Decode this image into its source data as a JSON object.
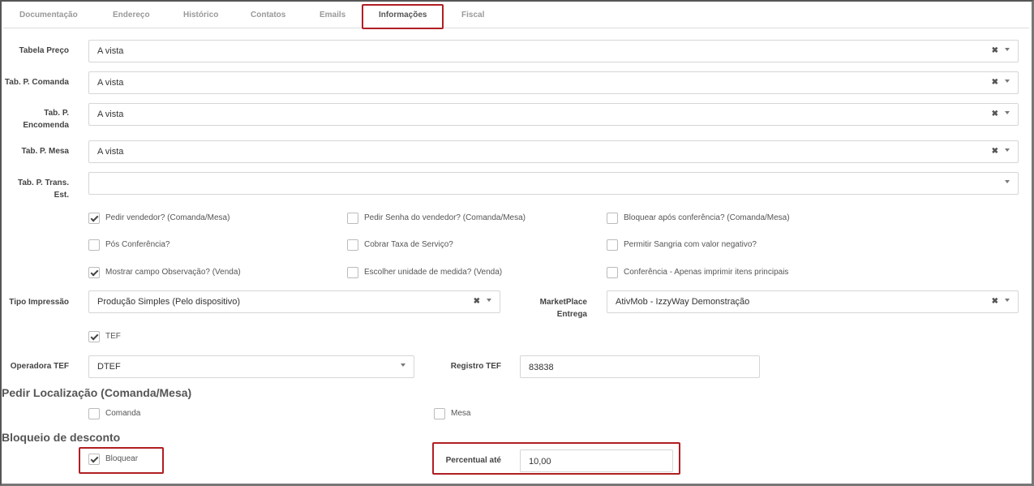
{
  "tabs": [
    {
      "label": "Documentação"
    },
    {
      "label": "Endereço"
    },
    {
      "label": "Histórico"
    },
    {
      "label": "Contatos"
    },
    {
      "label": "Emails"
    },
    {
      "label": "Informações"
    },
    {
      "label": "Fiscal"
    }
  ],
  "price_tables": [
    {
      "label": "Tabela Preço",
      "value": "A vista"
    },
    {
      "label": "Tab. P. Comanda",
      "value": "A vista"
    },
    {
      "label_line1": "Tab. P.",
      "label_line2": "Encomenda",
      "value": "A vista"
    },
    {
      "label": "Tab. P. Mesa",
      "value": "A vista"
    },
    {
      "label_line1": "Tab. P. Trans.",
      "label_line2": "Est.",
      "value": ""
    }
  ],
  "options": [
    {
      "label": "Pedir vendedor? (Comanda/Mesa)",
      "checked": true
    },
    {
      "label": "Pedir Senha do vendedor? (Comanda/Mesa)",
      "checked": false
    },
    {
      "label": "Bloquear após conferência? (Comanda/Mesa)",
      "checked": false
    },
    {
      "label": "Pós Conferência?",
      "checked": false
    },
    {
      "label": "Cobrar Taxa de Serviço?",
      "checked": false
    },
    {
      "label": "Permitir Sangria com valor negativo?",
      "checked": false
    },
    {
      "label": "Mostrar campo Observação? (Venda)",
      "checked": true
    },
    {
      "label": "Escolher unidade de medida? (Venda)",
      "checked": false
    },
    {
      "label": "Conferência - Apenas imprimir itens principais",
      "checked": false
    }
  ],
  "print_type": {
    "label": "Tipo Impressão",
    "value": "Produção Simples (Pelo dispositivo)"
  },
  "marketplace": {
    "label_line1": "MarketPlace",
    "label_line2": "Entrega",
    "value": "AtivMob - IzzyWay Demonstração"
  },
  "tef": {
    "label": "TEF",
    "checked": true
  },
  "tef_operator": {
    "label": "Operadora TEF",
    "value": "DTEF"
  },
  "tef_registry": {
    "label": "Registro TEF",
    "value": "83838"
  },
  "location": {
    "title": "Pedir Localização (Comanda/Mesa)",
    "comanda": {
      "label": "Comanda",
      "checked": false
    },
    "mesa": {
      "label": "Mesa",
      "checked": false
    }
  },
  "discount": {
    "title": "Bloqueio de desconto",
    "block": {
      "label": "Bloquear",
      "checked": true
    },
    "percent_label": "Percentual até",
    "percent_value": "10,00"
  },
  "icons": {
    "clear": "clear-icon",
    "dropdown": "chevron-down-icon",
    "check": "check-icon"
  },
  "colors": {
    "highlight": "#b01e23",
    "border": "#d6d6d6"
  }
}
